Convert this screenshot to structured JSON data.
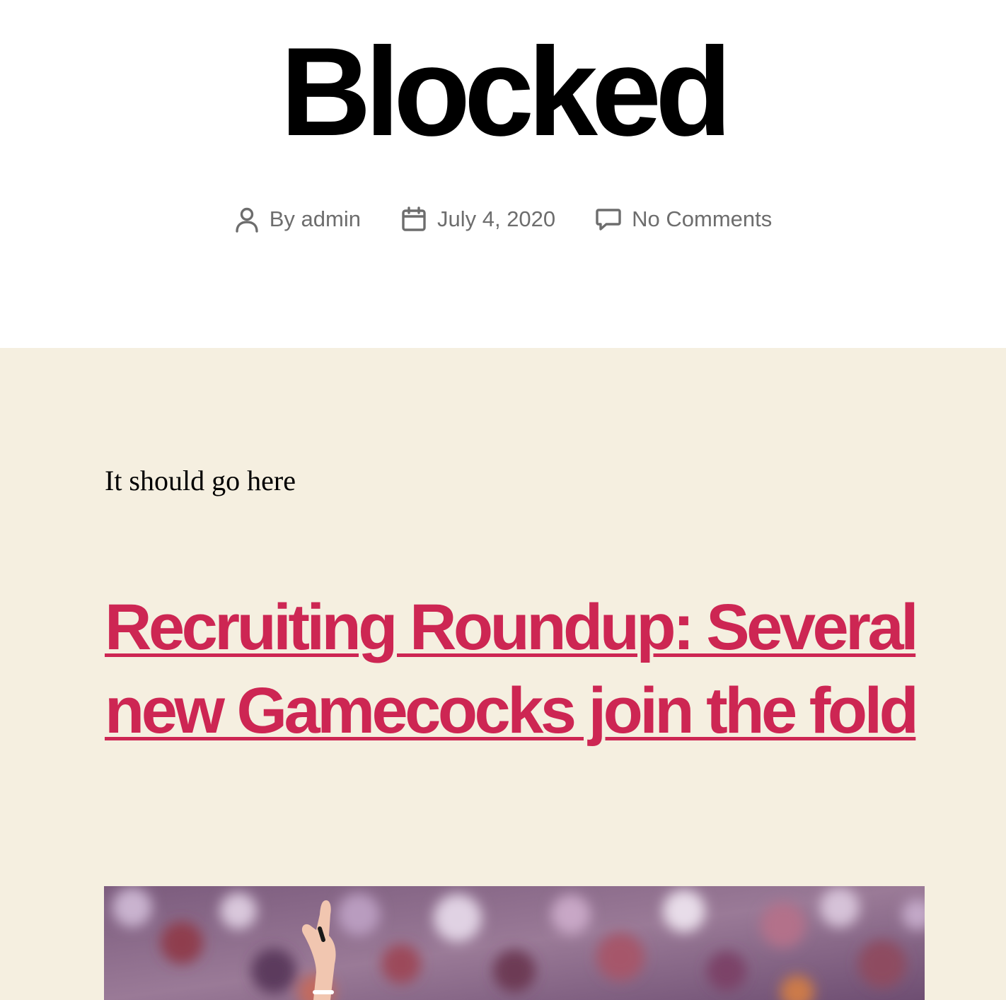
{
  "post": {
    "title": "Blocked",
    "meta": {
      "author_prefix": "By",
      "author": "admin",
      "date": "July 4, 2020",
      "comments": "No Comments"
    },
    "paragraph": "It should go here",
    "linked_post": {
      "title": "Recruiting Roundup: Several new Gamecocks join the fold"
    },
    "featured_image": {
      "alt": ""
    }
  },
  "colors": {
    "accent": "#cd2653",
    "content_background": "#f5efe0",
    "meta_text": "#6d6d6d"
  },
  "icons": {
    "author": "user-icon",
    "date": "calendar-icon",
    "comments": "comment-icon"
  }
}
